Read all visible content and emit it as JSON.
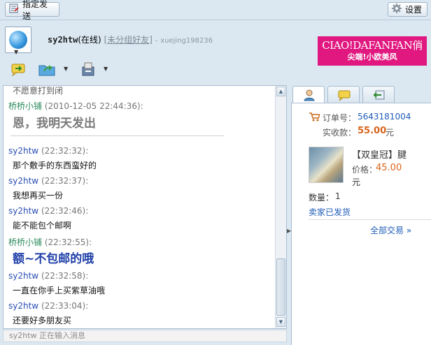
{
  "toolbar": {
    "send_to_label": "指定发送",
    "settings_label": "设置"
  },
  "contact": {
    "name": "sy2htw",
    "status": "(在线)",
    "group": "[未分组好友]",
    "separator": "-",
    "account": "xuejing198236"
  },
  "ad": {
    "brand": "CIAO!DAFANFAN俏",
    "slogan": "尖端!小欧美风"
  },
  "messages": {
    "partial_top": "不愿意打到闭",
    "m1": {
      "sender": "桥桥小铺",
      "time": "(2010-12-05 22:44:36):",
      "text": "恩，我明天发出"
    },
    "m2": {
      "sender": "sy2htw",
      "time": "(22:32:32):",
      "text": "那个敷手的东西蛮好的"
    },
    "m3": {
      "sender": "sy2htw",
      "time": "(22:32:37):",
      "text": "我想再买一份"
    },
    "m4": {
      "sender": "sy2htw",
      "time": "(22:32:46):",
      "text": "能不能包个邮啊"
    },
    "m5": {
      "sender": "桥桥小铺",
      "time": "(22:32:55):",
      "text": "额~不包邮的哦"
    },
    "m6": {
      "sender": "sy2htw",
      "time": "(22:32:58):",
      "text": "一直在你手上买紫草油哦"
    },
    "m7": {
      "sender": "sy2htw",
      "time": "(22:33:04):",
      "text": "还要好多朋友买"
    }
  },
  "typing_status": "sy2htw 正在输入消息",
  "order": {
    "order_no_label": "订单号：",
    "order_no": "5643181004",
    "paid_label": "实收款：",
    "paid_amount": "55.00",
    "paid_unit": "元",
    "product_name": "【双皇冠】腱",
    "price_label": "价格：",
    "price": "45.00",
    "price_unit": "元",
    "qty_label": "数量：",
    "qty": "1",
    "shipping_status": "卖家已发货",
    "all_orders": "全部交易 »"
  },
  "colors": {
    "accent_blue": "#2a4fb4",
    "seller_green": "#2c8a5c",
    "price_orange": "#d9641a",
    "ad_pink": "#e0187f"
  }
}
